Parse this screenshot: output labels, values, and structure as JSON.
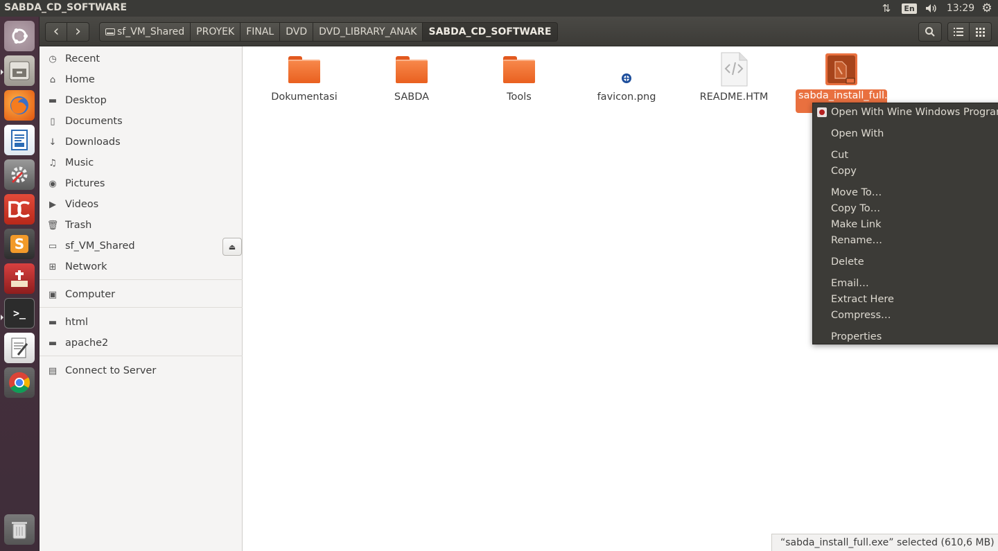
{
  "window": {
    "title": "SABDA_CD_SOFTWARE"
  },
  "top_panel": {
    "keyboard_layout": "En",
    "clock": "13:29",
    "network_icon": "network-updown-icon",
    "sound_icon": "volume-icon",
    "settings_icon": "gear-icon"
  },
  "launcher": {
    "items": [
      {
        "name": "ubuntu-dash"
      },
      {
        "name": "files"
      },
      {
        "name": "firefox"
      },
      {
        "name": "libreoffice-writer"
      },
      {
        "name": "system-settings"
      },
      {
        "name": "doublecmd"
      },
      {
        "name": "sublime-text",
        "glyph": "S"
      },
      {
        "name": "bible-app"
      },
      {
        "name": "terminal",
        "glyph": ">_"
      },
      {
        "name": "text-editor"
      },
      {
        "name": "chrome"
      },
      {
        "name": "trash"
      }
    ]
  },
  "toolbar": {
    "back_icon": "‹",
    "forward_icon": "›",
    "search_icon": "⌕",
    "list_view_icon": "☰",
    "grid_view_icon": "⋮⋮⋮"
  },
  "breadcrumbs": [
    "sf_VM_Shared",
    "PROYEK",
    "FINAL",
    "DVD",
    "DVD_LIBRARY_ANAK",
    "SABDA_CD_SOFTWARE"
  ],
  "sidebar": {
    "items": [
      {
        "label": "Recent",
        "icon": "clock-icon",
        "glyph": "◷"
      },
      {
        "label": "Home",
        "icon": "home-icon",
        "glyph": "⌂"
      },
      {
        "label": "Desktop",
        "icon": "folder-icon",
        "glyph": "▬"
      },
      {
        "label": "Documents",
        "icon": "document-icon",
        "glyph": "▯"
      },
      {
        "label": "Downloads",
        "icon": "download-icon",
        "glyph": "↓"
      },
      {
        "label": "Music",
        "icon": "music-icon",
        "glyph": "♫"
      },
      {
        "label": "Pictures",
        "icon": "camera-icon",
        "glyph": "◉"
      },
      {
        "label": "Videos",
        "icon": "video-icon",
        "glyph": "▶"
      },
      {
        "label": "Trash",
        "icon": "trash-icon",
        "glyph": "🗑"
      },
      {
        "label": "sf_VM_Shared",
        "icon": "drive-icon",
        "glyph": "▭"
      },
      {
        "label": "Network",
        "icon": "network-icon",
        "glyph": "⊞"
      },
      {
        "label": "Computer",
        "icon": "computer-icon",
        "glyph": "▣"
      },
      {
        "label": "html",
        "icon": "folder-icon",
        "glyph": "▬"
      },
      {
        "label": "apache2",
        "icon": "folder-icon",
        "glyph": "▬"
      },
      {
        "label": "Connect to Server",
        "icon": "server-icon",
        "glyph": "▤"
      }
    ],
    "eject_icon": "⏏"
  },
  "files": [
    {
      "name": "Dokumentasi",
      "type": "folder"
    },
    {
      "name": "SABDA",
      "type": "folder"
    },
    {
      "name": "Tools",
      "type": "folder"
    },
    {
      "name": "favicon.png",
      "type": "image"
    },
    {
      "name": "README.HTM",
      "type": "html"
    },
    {
      "name": "sabda_install_full.exe",
      "type": "exe",
      "selected": true
    }
  ],
  "context_menu": {
    "items": [
      "Open With Wine Windows Program Loader",
      "Open With",
      "Cut",
      "Copy",
      "Move To…",
      "Copy To…",
      "Make Link",
      "Rename…",
      "Delete",
      "Email…",
      "Extract Here",
      "Compress…",
      "Properties"
    ]
  },
  "status": {
    "text": "“sabda_install_full.exe” selected  (610,6 MB)"
  },
  "colors": {
    "accent": "#e9703f",
    "panel": "#3a3a37",
    "launcher": "#4a3340",
    "menu_bg": "#3c3b37"
  }
}
